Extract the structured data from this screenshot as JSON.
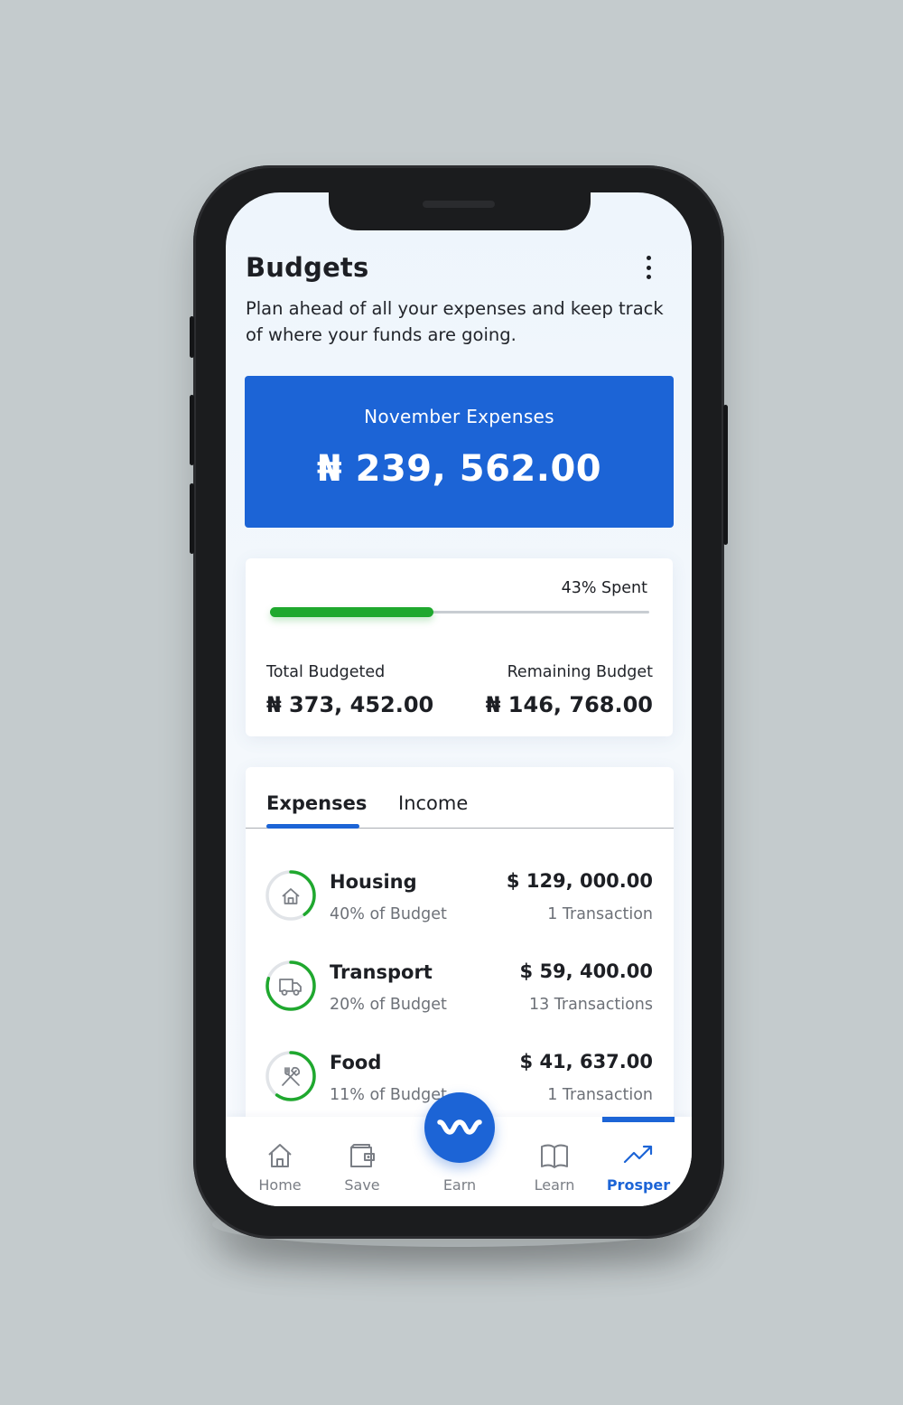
{
  "header": {
    "title": "Budgets",
    "subtitle": "Plan ahead of all your expenses and keep track of where your funds are going.",
    "menu_icon": "more-vertical-icon"
  },
  "expense_summary": {
    "label": "November Expenses",
    "amount": "₦ 239, 562.00",
    "color": "#1c64d6"
  },
  "budget": {
    "spent_label": "43% Spent",
    "spent_fraction": 0.43,
    "total_label": "Total Budgeted",
    "total_value": "₦ 373, 452.00",
    "remaining_label": "Remaining Budget",
    "remaining_value": "₦ 146, 768.00",
    "progress_color": "#1fa82e"
  },
  "tabs": [
    {
      "label": "Expenses",
      "active": true
    },
    {
      "label": "Income",
      "active": false
    }
  ],
  "categories": [
    {
      "name": "Housing",
      "percent_label": "40% of Budget",
      "amount": "$ 129, 000.00",
      "transactions": "1 Transaction",
      "icon": "house-icon",
      "ring_fraction": 0.4
    },
    {
      "name": "Transport",
      "percent_label": "20% of Budget",
      "amount": "$ 59, 400.00",
      "transactions": "13 Transactions",
      "icon": "truck-icon",
      "ring_fraction": 0.8
    },
    {
      "name": "Food",
      "percent_label": "11% of Budget",
      "amount": "$ 41, 637.00",
      "transactions": "1 Transaction",
      "icon": "fork-knife-icon",
      "ring_fraction": 0.6
    }
  ],
  "nav": {
    "items": [
      {
        "label": "Home",
        "icon": "home-icon"
      },
      {
        "label": "Save",
        "icon": "wallet-icon"
      },
      {
        "label": "Earn",
        "icon": "earn-logo-icon"
      },
      {
        "label": "Learn",
        "icon": "book-icon"
      },
      {
        "label": "Prosper",
        "icon": "trending-up-icon",
        "active": true
      }
    ]
  }
}
